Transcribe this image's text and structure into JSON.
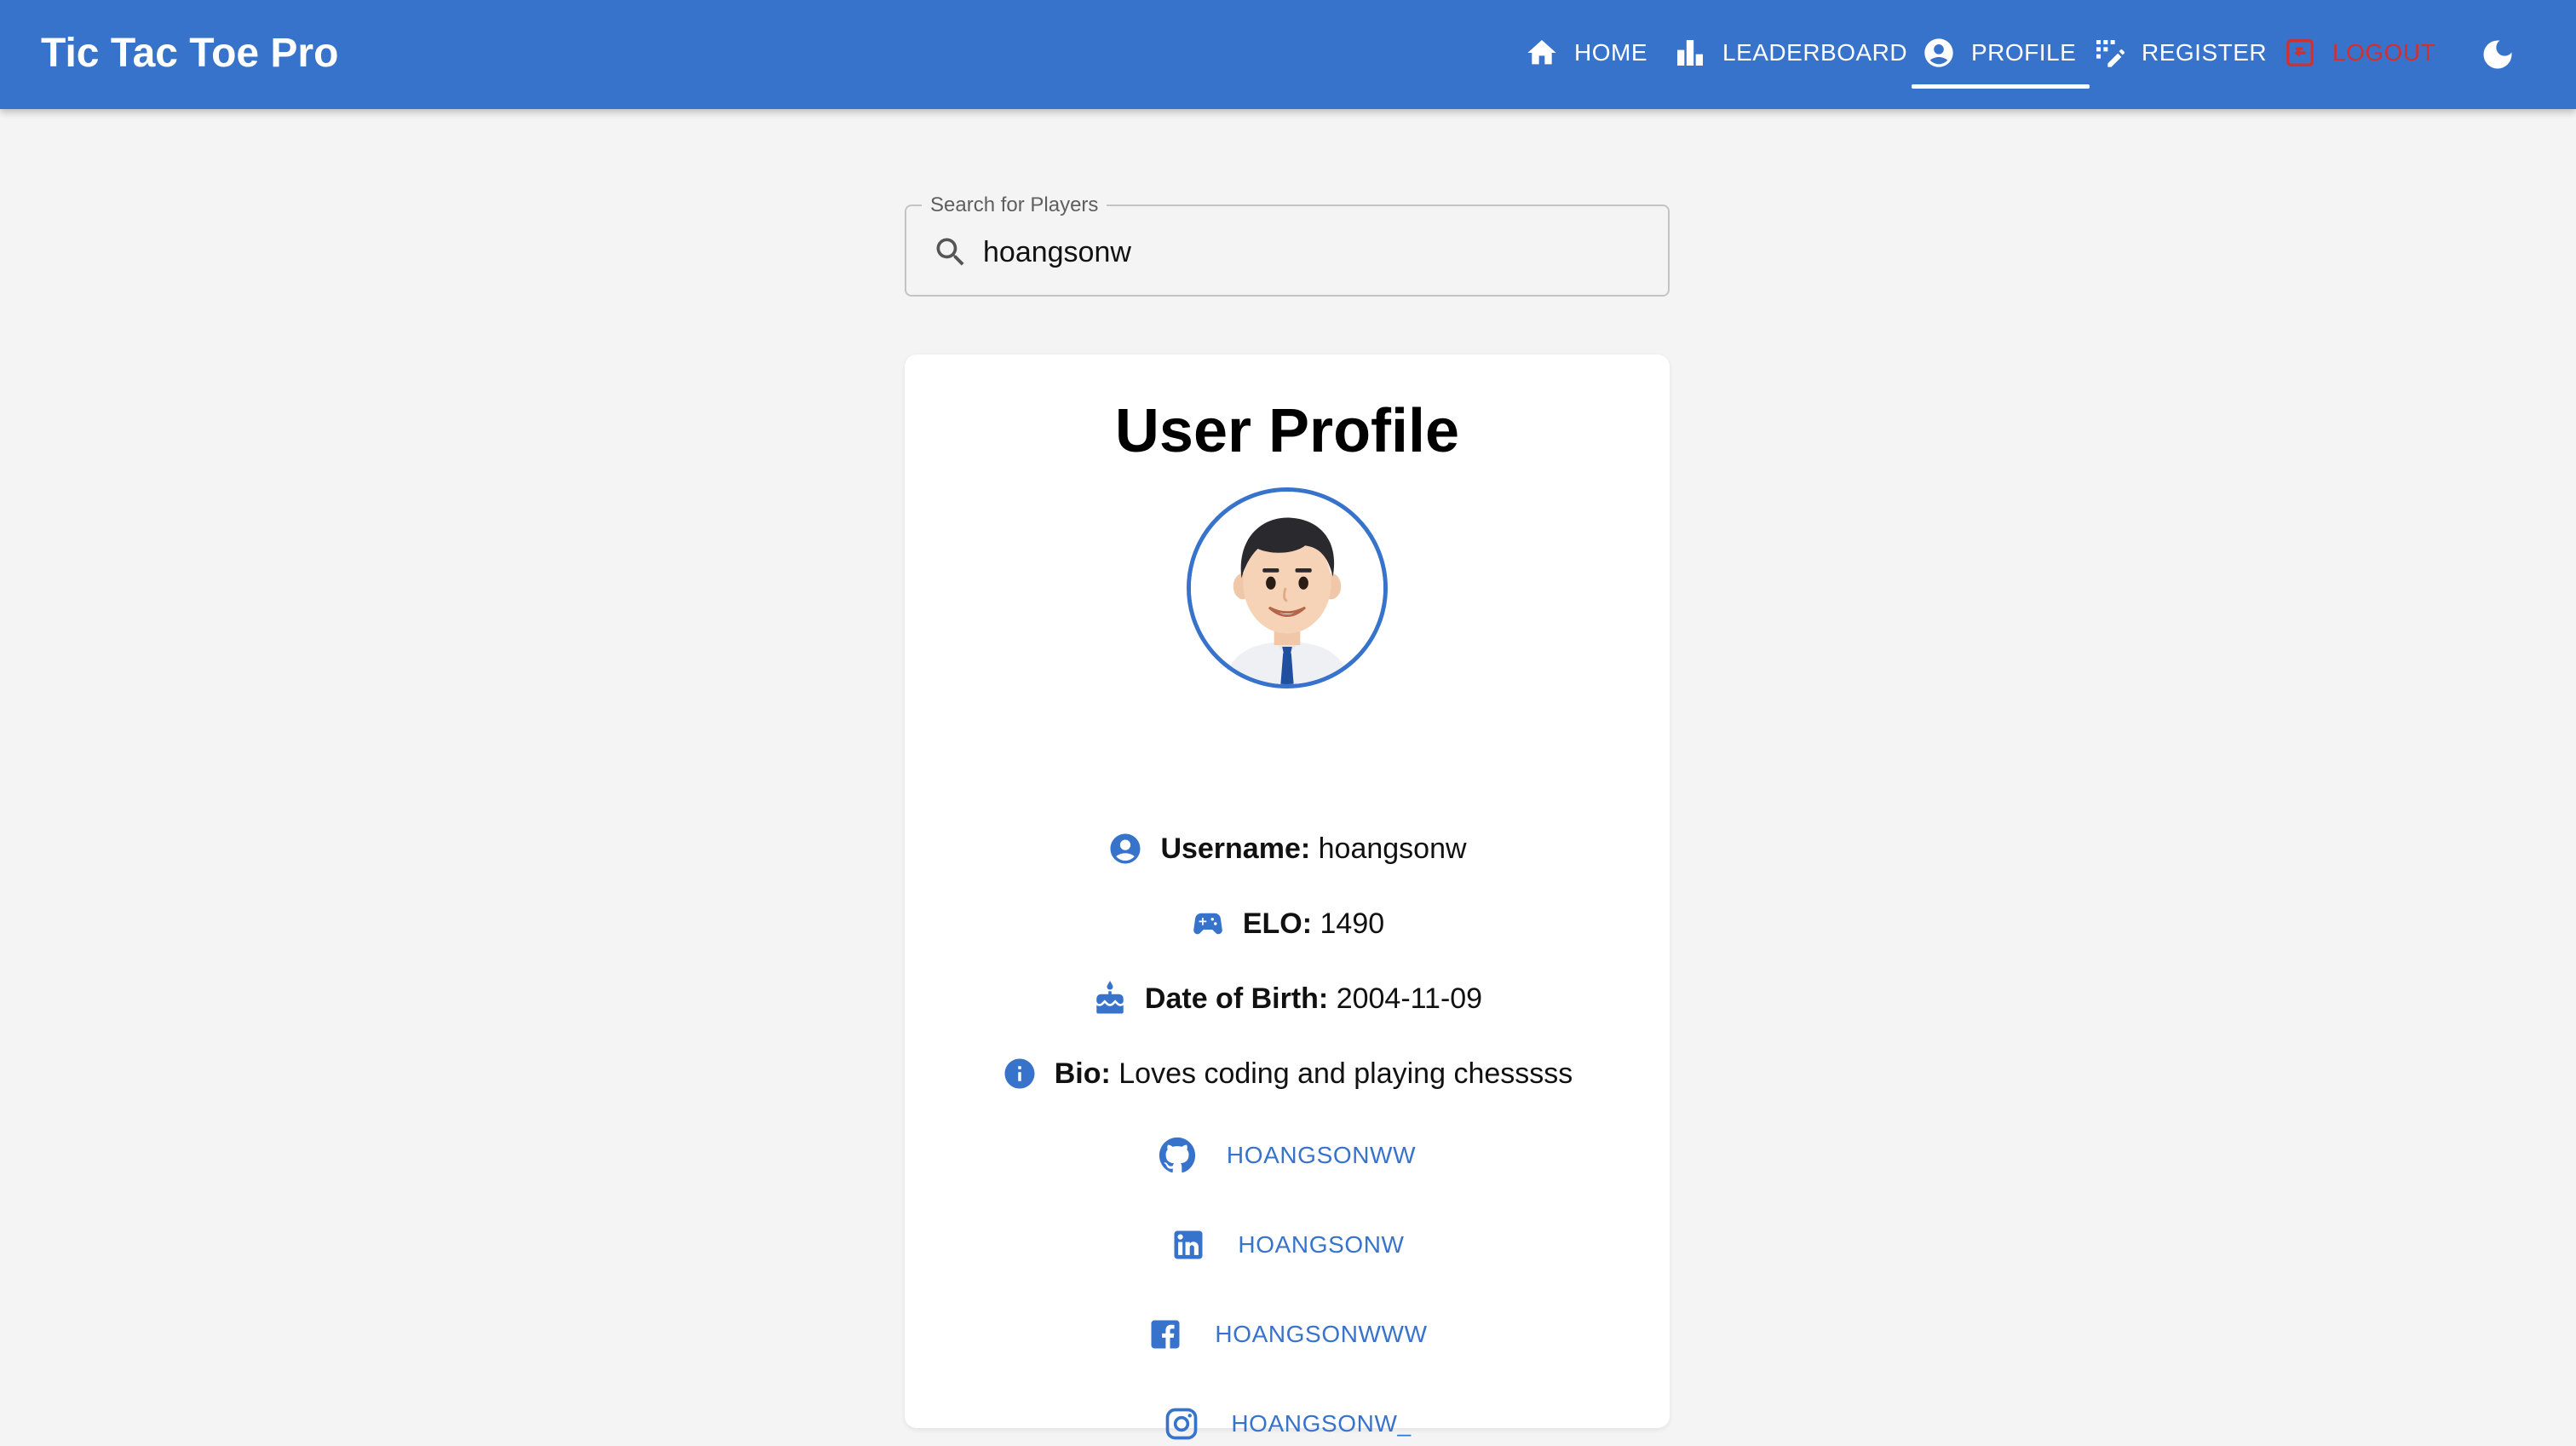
{
  "app": {
    "title": "Tic Tac Toe Pro"
  },
  "nav": {
    "items": [
      {
        "label": "HOME",
        "icon": "home-icon"
      },
      {
        "label": "LEADERBOARD",
        "icon": "leaderboard-icon"
      },
      {
        "label": "PROFILE",
        "icon": "account-circle-icon",
        "active": true
      },
      {
        "label": "REGISTER",
        "icon": "register-icon"
      },
      {
        "label": "LOGOUT",
        "icon": "logout-icon"
      }
    ],
    "theme_toggle_icon": "moon-icon"
  },
  "search": {
    "label": "Search for Players",
    "value": "hoangsonw",
    "icon": "search-icon"
  },
  "profile": {
    "title": "User Profile",
    "avatar_icon": "avatar-image",
    "fields": [
      {
        "label": "Username:",
        "value": "hoangsonw",
        "icon": "account-circle-icon"
      },
      {
        "label": "ELO:",
        "value": "1490",
        "icon": "gamepad-icon"
      },
      {
        "label": "Date of Birth:",
        "value": "2004-11-09",
        "icon": "cake-icon"
      },
      {
        "label": "Bio:",
        "value": "Loves coding and playing chesssss",
        "icon": "info-icon"
      }
    ],
    "socials": [
      {
        "label": "HOANGSONWW",
        "icon": "github-icon"
      },
      {
        "label": "HOANGSONW",
        "icon": "linkedin-icon"
      },
      {
        "label": "HOANGSONWWW",
        "icon": "facebook-icon"
      },
      {
        "label": "HOANGSONW_",
        "icon": "instagram-icon"
      }
    ]
  },
  "colors": {
    "primary": "#3873cb",
    "background": "#f4f4f4",
    "logout": "#d32f2f",
    "card": "#ffffff"
  }
}
